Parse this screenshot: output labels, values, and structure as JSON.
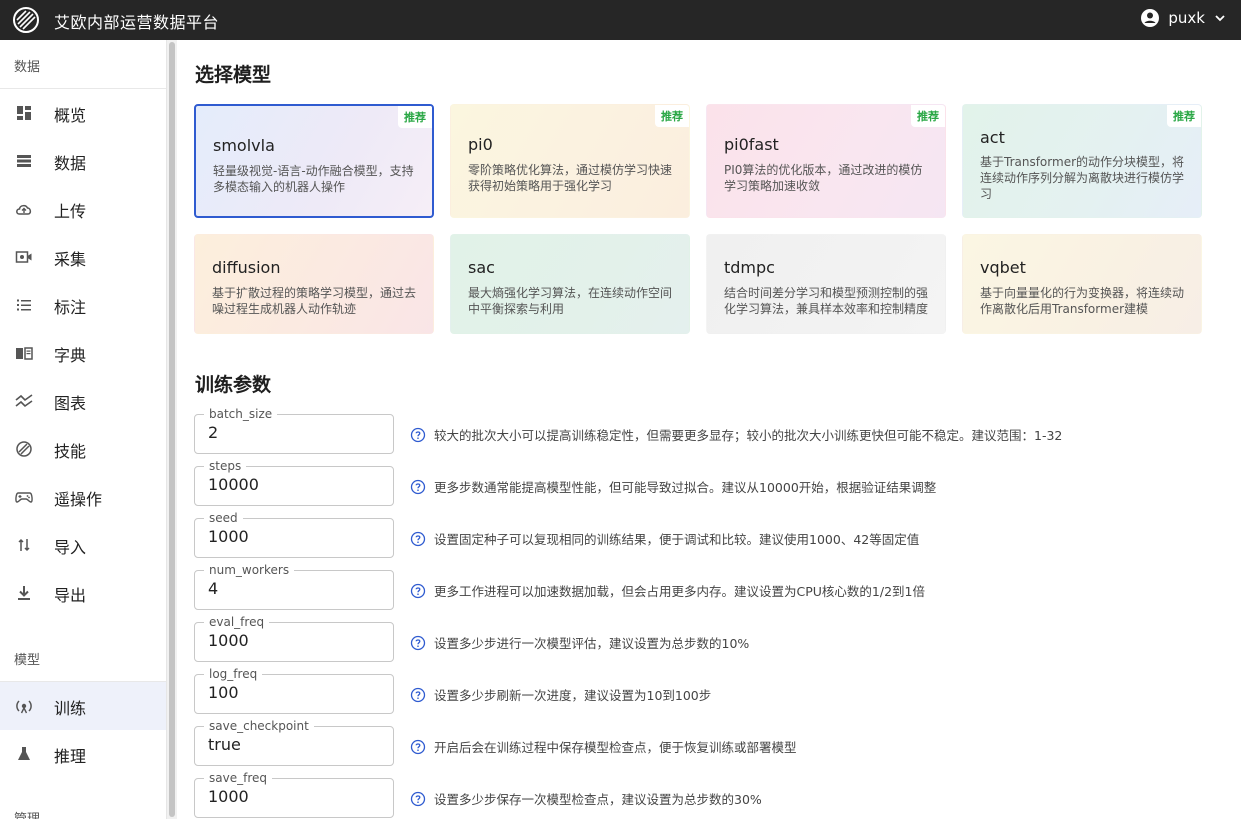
{
  "app": {
    "title": "艾欧内部运营数据平台",
    "logo_icon": "logo-icon"
  },
  "user": {
    "name": "puxk",
    "icon": "account-circle-icon",
    "menu_icon": "chevron-down-icon"
  },
  "sidebar": {
    "sections": [
      {
        "label": "数据"
      },
      {
        "label": "模型"
      },
      {
        "label": "管理"
      }
    ],
    "items": [
      {
        "label": "概览",
        "icon": "dashboard-icon"
      },
      {
        "label": "数据",
        "icon": "list-icon"
      },
      {
        "label": "上传",
        "icon": "cloud-upload-icon"
      },
      {
        "label": "采集",
        "icon": "camera-icon"
      },
      {
        "label": "标注",
        "icon": "checklist-icon"
      },
      {
        "label": "字典",
        "icon": "book-icon"
      },
      {
        "label": "图表",
        "icon": "chart-icon"
      },
      {
        "label": "技能",
        "icon": "skill-icon"
      },
      {
        "label": "遥操作",
        "icon": "gamepad-icon"
      },
      {
        "label": "导入",
        "icon": "import-icon"
      },
      {
        "label": "导出",
        "icon": "download-icon"
      },
      {
        "label": "训练",
        "icon": "training-icon",
        "active": true
      },
      {
        "label": "推理",
        "icon": "flask-icon"
      }
    ]
  },
  "model_section": {
    "title": "选择模型",
    "badge": "推荐"
  },
  "models": [
    {
      "name": "smolvla",
      "desc": "轻量级视觉-语言-动作融合模型，支持多模态输入的机器人操作",
      "recommended": true,
      "selected": true
    },
    {
      "name": "pi0",
      "desc": "零阶策略优化算法，通过模仿学习快速获得初始策略用于强化学习",
      "recommended": true
    },
    {
      "name": "pi0fast",
      "desc": "PI0算法的优化版本，通过改进的模仿学习策略加速收敛",
      "recommended": true
    },
    {
      "name": "act",
      "desc": "基于Transformer的动作分块模型，将连续动作序列分解为离散块进行模仿学习",
      "recommended": true
    },
    {
      "name": "diffusion",
      "desc": "基于扩散过程的策略学习模型，通过去噪过程生成机器人动作轨迹"
    },
    {
      "name": "sac",
      "desc": "最大熵强化学习算法，在连续动作空间中平衡探索与利用"
    },
    {
      "name": "tdmpc",
      "desc": "结合时间差分学习和模型预测控制的强化学习算法，兼具样本效率和控制精度"
    },
    {
      "name": "vqbet",
      "desc": "基于向量量化的行为变换器，将连续动作离散化后用Transformer建模"
    }
  ],
  "params_section": {
    "title": "训练参数",
    "hint_icon": "help-circle-icon"
  },
  "params": [
    {
      "label": "batch_size",
      "value": "2",
      "hint": "较大的批次大小可以提高训练稳定性，但需要更多显存；较小的批次大小训练更快但可能不稳定。建议范围：1-32"
    },
    {
      "label": "steps",
      "value": "10000",
      "hint": "更多步数通常能提高模型性能，但可能导致过拟合。建议从10000开始，根据验证结果调整"
    },
    {
      "label": "seed",
      "value": "1000",
      "hint": "设置固定种子可以复现相同的训练结果，便于调试和比较。建议使用1000、42等固定值"
    },
    {
      "label": "num_workers",
      "value": "4",
      "hint": "更多工作进程可以加速数据加载，但会占用更多内存。建议设置为CPU核心数的1/2到1倍"
    },
    {
      "label": "eval_freq",
      "value": "1000",
      "hint": "设置多少步进行一次模型评估，建议设置为总步数的10%"
    },
    {
      "label": "log_freq",
      "value": "100",
      "hint": "设置多少步刷新一次进度，建议设置为10到100步"
    },
    {
      "label": "save_checkpoint",
      "value": "true",
      "hint": "开启后会在训练过程中保存模型检查点，便于恢复训练或部署模型"
    },
    {
      "label": "save_freq",
      "value": "1000",
      "hint": "设置多少步保存一次模型检查点，建议设置为总步数的30%"
    }
  ]
}
